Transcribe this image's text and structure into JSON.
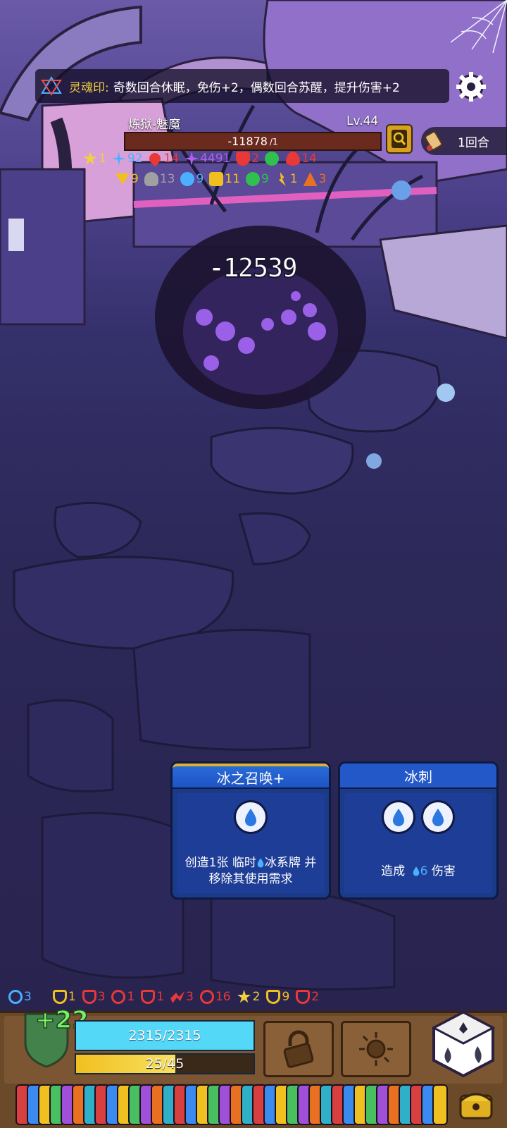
{
  "soul_seal": {
    "label": "灵魂印:",
    "text": "奇数回合休眠，免伤+2，偶数回合苏醒，提升伤害+2"
  },
  "enemy": {
    "name": "炼狱-魅魔",
    "level": "Lv.44",
    "hp": "-11878",
    "hp_sub": "/1",
    "status_row1": [
      {
        "icon": "star-icon",
        "value": "1",
        "color": "#f0d040"
      },
      {
        "icon": "snowflake-icon",
        "value": "92",
        "color": "#4ab0ff"
      },
      {
        "icon": "blood-drop-icon",
        "value": "14",
        "color": "#e83838"
      },
      {
        "icon": "purple-burst-icon",
        "value": "4491",
        "color": "#b060f0"
      },
      {
        "icon": "heart-shield-icon",
        "value": "2",
        "color": "#e83838"
      },
      {
        "icon": "poison-icon",
        "value": "",
        "color": "#30c050"
      },
      {
        "icon": "flame-icon",
        "value": "14",
        "color": "#e83838"
      }
    ],
    "status_row2": [
      {
        "icon": "chevron-weak-icon",
        "value": "9",
        "color": "#f0c020"
      },
      {
        "icon": "skull-icon",
        "value": "13",
        "color": "#a0a0a0"
      },
      {
        "icon": "chat-bubble-icon",
        "value": "9",
        "color": "#4ab0ff"
      },
      {
        "icon": "lock-icon",
        "value": "11",
        "color": "#f0c020"
      },
      {
        "icon": "poison-swirl-icon",
        "value": "9",
        "color": "#30c050"
      },
      {
        "icon": "spark-icon",
        "value": "1",
        "color": "#f0c020"
      },
      {
        "icon": "fire-mountain-icon",
        "value": "3",
        "color": "#e87020"
      }
    ]
  },
  "round": {
    "label": "1回合"
  },
  "damage_popup": "-12539",
  "cards": [
    {
      "title": "冰之召唤+",
      "desc_line1": "创造1张 临时",
      "desc_drop": "",
      "desc_line1b": "冰系牌 并",
      "desc_line2": "移除其使用需求",
      "drops": 1
    },
    {
      "title": "冰刺",
      "desc_a": "造成",
      "desc_num": "6",
      "desc_b": "伤害",
      "drops": 2
    }
  ],
  "player": {
    "buffs": [
      {
        "icon": "target-ring-icon",
        "value": "3",
        "color": "#4ab0ff"
      },
      {
        "icon": "blank-icon",
        "value": "",
        "color": "#f0c020"
      },
      {
        "icon": "shield-star-icon",
        "value": "1",
        "color": "#f0c020"
      },
      {
        "icon": "heart-icon",
        "value": "3",
        "color": "#e83838"
      },
      {
        "icon": "crosshair-icon",
        "value": "1",
        "color": "#e83838"
      },
      {
        "icon": "sword-shield-icon",
        "value": "1",
        "color": "#e83838"
      },
      {
        "icon": "slash-icon",
        "value": "3",
        "color": "#e83838"
      },
      {
        "icon": "spiral-icon",
        "value": "16",
        "color": "#e83838"
      },
      {
        "icon": "star-icon",
        "value": "2",
        "color": "#f0d040"
      },
      {
        "icon": "shield-ring-icon",
        "value": "9",
        "color": "#f0c020"
      },
      {
        "icon": "shield-sword-icon",
        "value": "2",
        "color": "#e83838"
      }
    ],
    "armor_gain": "+22",
    "armor_value": "25",
    "hp": "2315/2315",
    "energy": "25/45",
    "energy_fraction": 0.56
  },
  "deck_colors": [
    "#d84040",
    "#3a8af0",
    "#f0c020",
    "#48c060",
    "#a050d8",
    "#e87020",
    "#30b0c8",
    "#d84040",
    "#3a8af0",
    "#f0c020",
    "#48c060",
    "#a050d8",
    "#e87020",
    "#30b0c8",
    "#d84040",
    "#3a8af0",
    "#f0c020",
    "#48c060",
    "#a050d8",
    "#e87020",
    "#30b0c8",
    "#d84040",
    "#3a8af0",
    "#f0c020",
    "#48c060",
    "#a050d8",
    "#e87020",
    "#30b0c8",
    "#d84040",
    "#3a8af0",
    "#f0c020",
    "#48c060",
    "#a050d8",
    "#e87020",
    "#30b0c8",
    "#d84040",
    "#3a8af0",
    "#f0c020"
  ]
}
